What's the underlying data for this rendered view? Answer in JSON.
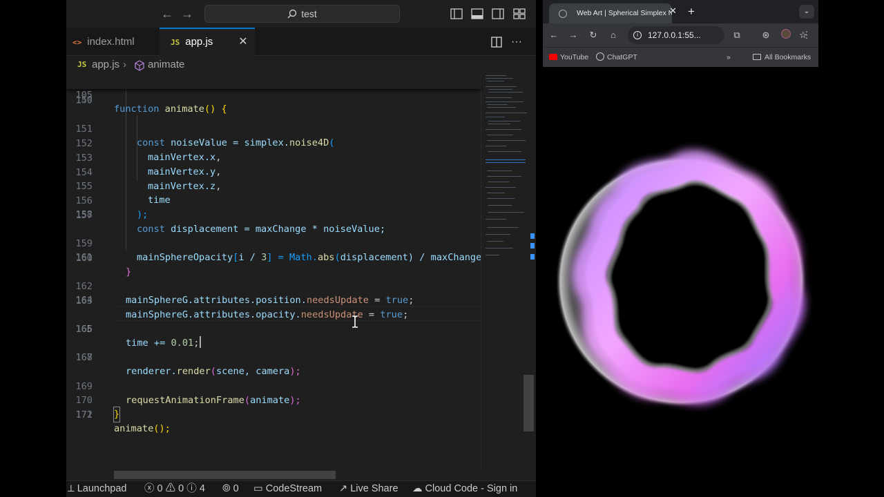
{
  "vscode": {
    "search_text": "test",
    "tabs": [
      {
        "icon": "<>",
        "label": "index.html"
      },
      {
        "icon": "JS",
        "label": "app.js"
      }
    ],
    "breadcrumb": {
      "file_icon": "JS",
      "file": "app.js",
      "symbol": "animate"
    },
    "sticky": {
      "number": "105",
      "code": "function animate() {"
    },
    "partial_number": "149",
    "lines": [
      {
        "n": "150"
      },
      {
        "n": "151"
      },
      {
        "n": "152"
      },
      {
        "n": "153"
      },
      {
        "n": "154"
      },
      {
        "n": "155"
      },
      {
        "n": "156"
      },
      {
        "n": "157"
      },
      {
        "n": "158"
      },
      {
        "n": "159"
      },
      {
        "n": "160"
      },
      {
        "n": "161"
      },
      {
        "n": "162"
      },
      {
        "n": "163"
      },
      {
        "n": "164"
      },
      {
        "n": "165"
      },
      {
        "n": "166"
      },
      {
        "n": "167"
      },
      {
        "n": "168"
      },
      {
        "n": "169"
      },
      {
        "n": "170"
      },
      {
        "n": "171"
      },
      {
        "n": "172"
      }
    ],
    "code": {
      "l151": [
        "const",
        " noiseValue = simplex.",
        "noise4D",
        "("
      ],
      "l152": "mainVertex.",
      "l152p": "x",
      "comma": ",",
      "l153p": "y",
      "l154p": "z",
      "l155": "time",
      "l156": ");",
      "l157": [
        "const",
        " displacement = maxChange * noiseValue;"
      ],
      "l159": [
        "mainSphereOpacity",
        "[",
        "i / ",
        "3",
        "] = Math.",
        "abs",
        "(",
        "displacement",
        ") / maxChange"
      ],
      "l160": "}",
      "l162": [
        "mainSphereG.attributes.position.",
        "needsUpdate",
        " = ",
        "true",
        ";"
      ],
      "l163": [
        "mainSphereG.attributes.opacity.",
        "needsUpdate",
        " = ",
        "true",
        ";"
      ],
      "l165": [
        "time += ",
        "0.01",
        ";"
      ],
      "l167": [
        "renderer.",
        "render",
        "(",
        "scene, camera",
        ");"
      ],
      "l169": [
        "requestAnimationFrame",
        "(",
        "animate",
        ");"
      ],
      "l170": "}",
      "l171": [
        "animate",
        "();"
      ]
    },
    "status": {
      "launchpad": "Launchpad",
      "problems": "0",
      "warnings": "0",
      "info": "4",
      "ports": "0",
      "codestream": "CodeStream",
      "liveshare": "Live Share",
      "cloudcode": "Cloud Code - Sign in"
    }
  },
  "browser": {
    "tab_title": "Web Art | Spherical Simplex N",
    "url": "127.0.0.1:55...",
    "bookmarks": [
      "YouTube",
      "ChatGPT",
      "All Bookmarks"
    ]
  },
  "colors": {
    "editor_bg": "#1f1f1f",
    "accent": "#0078d4",
    "ring_pink": "#e86cf0",
    "ring_violet": "#9a78ff"
  }
}
